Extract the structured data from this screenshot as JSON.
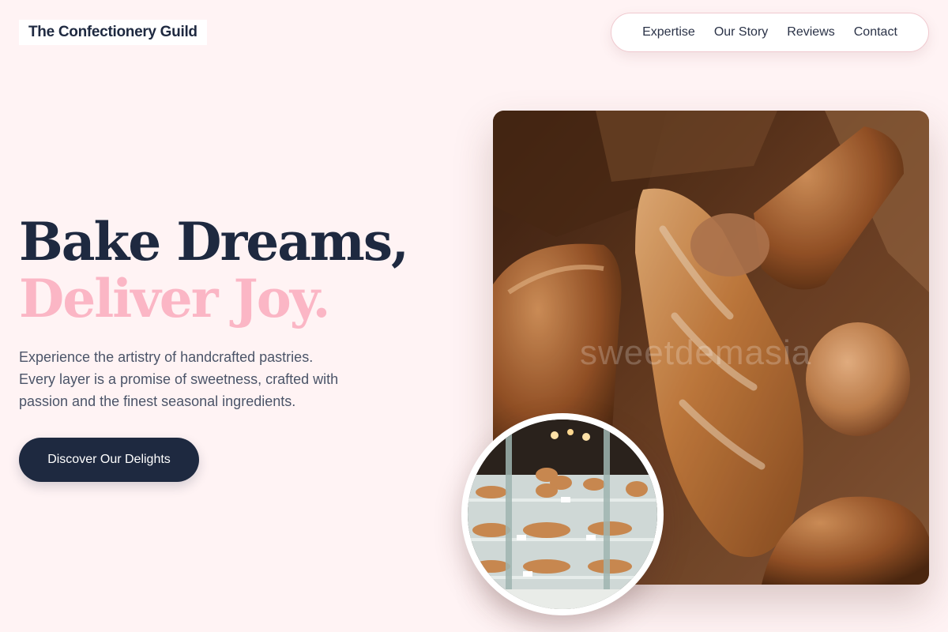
{
  "brand": {
    "name": "The Confectionery Guild"
  },
  "nav": {
    "items": [
      {
        "label": "Expertise"
      },
      {
        "label": "Our Story"
      },
      {
        "label": "Reviews"
      },
      {
        "label": "Contact"
      }
    ]
  },
  "hero": {
    "headline_line1": "Bake Dreams,",
    "headline_line2": "Deliver Joy.",
    "lede_lines": [
      "Experience the artistry of handcrafted pastries.",
      "Every layer is a promise of sweetness, crafted with",
      "passion and the finest seasonal ingredients."
    ],
    "cta_label": "Discover Our Delights",
    "photo_watermark": "sweetdemasia"
  },
  "colors": {
    "background": "#fff3f4",
    "navy": "#1e2940",
    "accent_pink": "#fbb6c5",
    "body_text": "#4b5468"
  },
  "images": {
    "hero": "bread-loaves-in-paper-bag",
    "inset": "bakery-display-case"
  }
}
